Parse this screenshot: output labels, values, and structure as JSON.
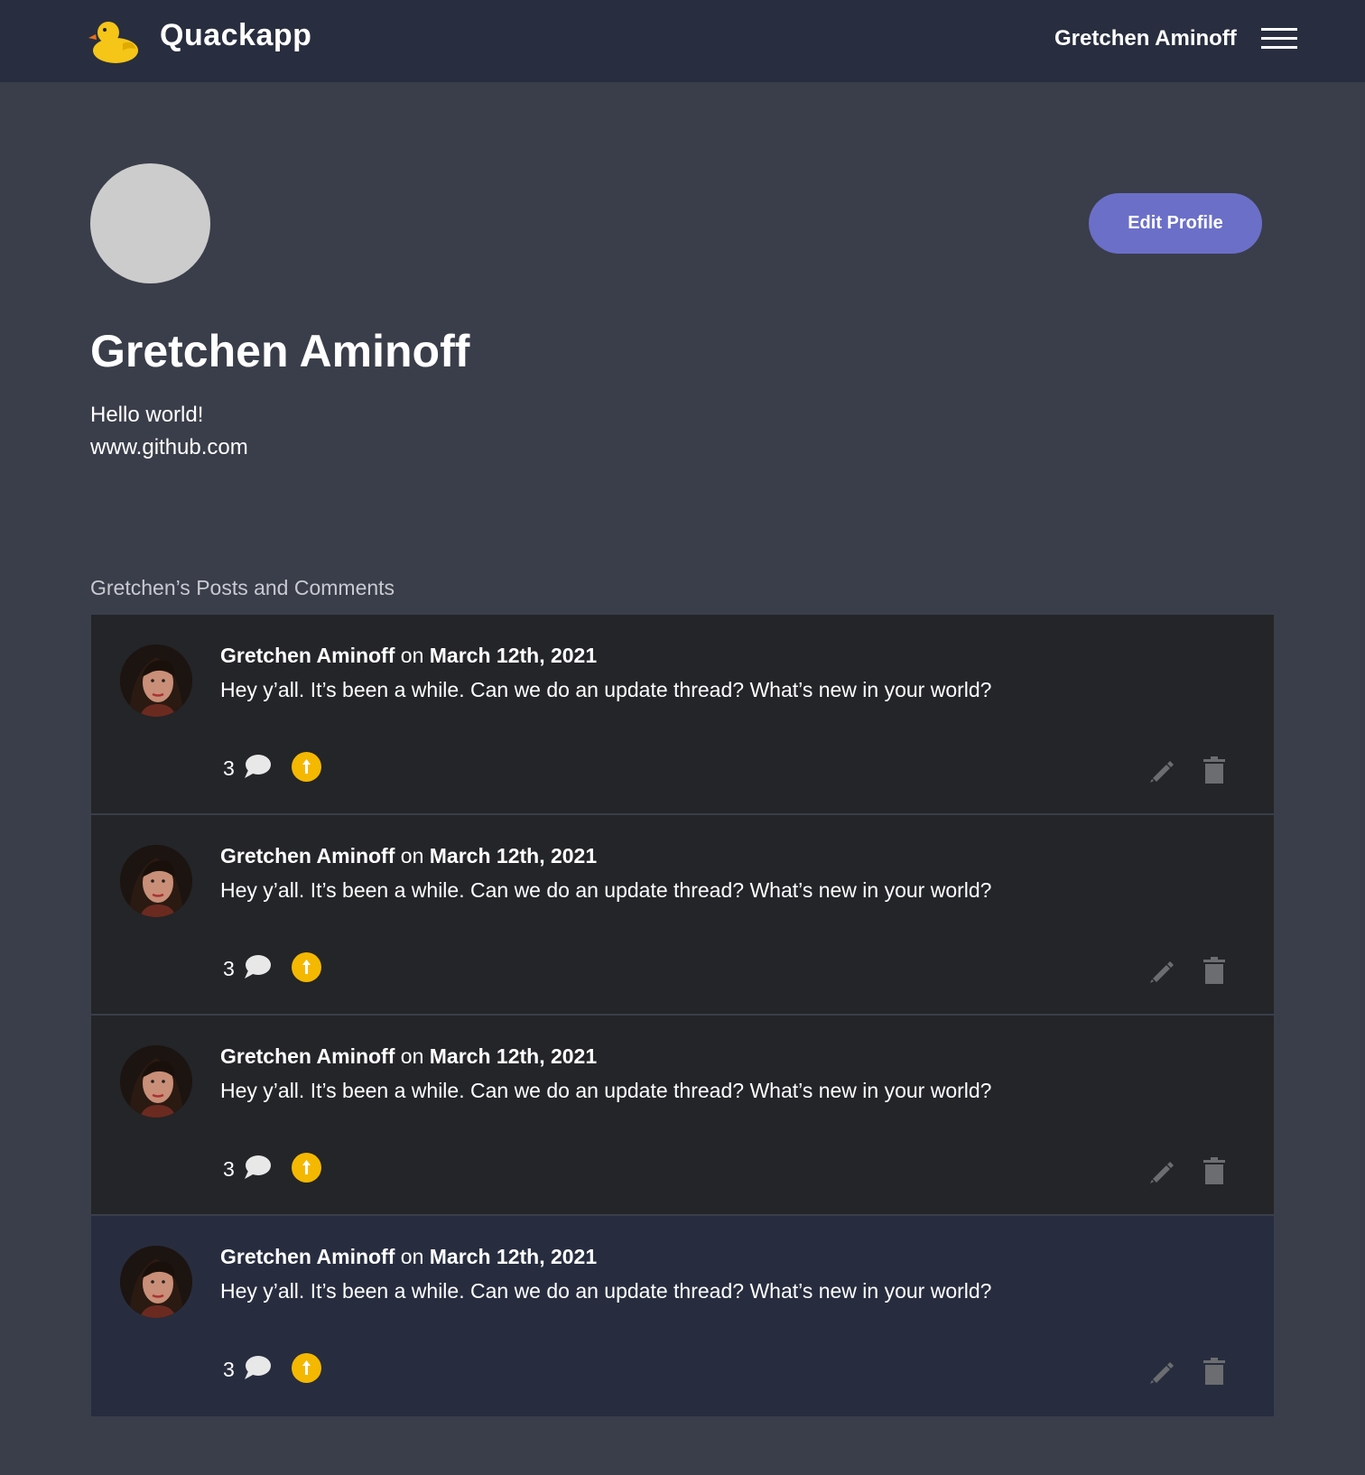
{
  "header": {
    "app_name": "Quackapp",
    "logo_icon": "rubber-duck-icon",
    "user_name": "Gretchen Aminoff",
    "menu_icon": "hamburger-menu-icon"
  },
  "profile": {
    "name": "Gretchen Aminoff",
    "bio": "Hello world!",
    "website": "www.github.com",
    "edit_button_label": "Edit Profile"
  },
  "section_title": "Gretchen’s Posts and Comments",
  "posts": [
    {
      "author": "Gretchen Aminoff",
      "connector": "on",
      "date": "March 12th, 2021",
      "text": "Hey y’all. It’s been a while. Can we do an update thread? What’s new in your world?",
      "comment_count": "3"
    },
    {
      "author": "Gretchen Aminoff",
      "connector": "on",
      "date": "March 12th, 2021",
      "text": "Hey y’all. It’s been a while. Can we do an update thread? What’s new in your world?",
      "comment_count": "3"
    },
    {
      "author": "Gretchen Aminoff",
      "connector": "on",
      "date": "March 12th, 2021",
      "text": "Hey y’all. It’s been a while. Can we do an update thread? What’s new in your world?",
      "comment_count": "3"
    },
    {
      "author": "Gretchen Aminoff",
      "connector": "on",
      "date": "March 12th, 2021",
      "text": "Hey y’all. It’s been a while. Can we do an update thread? What’s new in your world?",
      "comment_count": "3"
    }
  ],
  "colors": {
    "page_bg": "#3a3e4a",
    "header_bg": "#282e3f",
    "post_bg": "#232528",
    "post_highlight_bg": "#272d3f",
    "accent_button": "#6b6fc8",
    "upvote": "#f5b800",
    "muted_icon": "#6b6d70"
  }
}
